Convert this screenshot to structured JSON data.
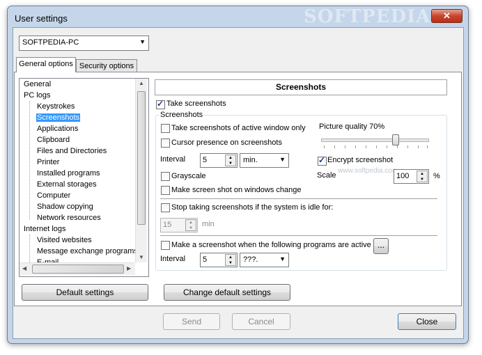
{
  "window": {
    "title": "User settings",
    "watermark": "SOFTPEDIA",
    "close_glyph": "✕"
  },
  "computer_select": {
    "value": "SOFTPEDIA-PC"
  },
  "tabs": [
    {
      "label": "General options",
      "active": true
    },
    {
      "label": "Security options",
      "active": false
    }
  ],
  "tree": {
    "items": [
      {
        "label": "General",
        "level": 0
      },
      {
        "label": "PC logs",
        "level": 0
      },
      {
        "label": "Keystrokes",
        "level": 1
      },
      {
        "label": "Screenshots",
        "level": 1,
        "selected": true
      },
      {
        "label": "Applications",
        "level": 1
      },
      {
        "label": "Clipboard",
        "level": 1
      },
      {
        "label": "Files and Directories",
        "level": 1
      },
      {
        "label": "Printer",
        "level": 1
      },
      {
        "label": "Installed programs",
        "level": 1
      },
      {
        "label": "External storages",
        "level": 1
      },
      {
        "label": "Computer",
        "level": 1
      },
      {
        "label": "Shadow copying",
        "level": 1
      },
      {
        "label": "Network resources",
        "level": 1
      },
      {
        "label": "Internet logs",
        "level": 0
      },
      {
        "label": "Visited websites",
        "level": 1
      },
      {
        "label": "Message exchange programs",
        "level": 1
      },
      {
        "label": "E-mail",
        "level": 1
      }
    ]
  },
  "panel": {
    "header": "Screenshots",
    "take_screenshots": {
      "label": "Take screenshots",
      "checked": true
    },
    "group_label": "Screenshots",
    "active_window": {
      "label": "Take screenshots of active window only",
      "checked": false
    },
    "cursor": {
      "label": "Cursor presence on screenshots",
      "checked": false
    },
    "picture_quality": {
      "label": "Picture quality 70%",
      "value": 70
    },
    "interval": {
      "label": "Interval",
      "value": "5",
      "unit": "min."
    },
    "encrypt": {
      "label": "Encrypt screenshot",
      "checked": true
    },
    "grayscale": {
      "label": "Grayscale",
      "checked": false
    },
    "scale": {
      "label": "Scale",
      "value": "100",
      "unit": "%"
    },
    "window_change": {
      "label": "Make screen shot on windows change",
      "checked": false
    },
    "idle": {
      "label": "Stop taking screenshots if the system is idle for:",
      "checked": false,
      "value": "15",
      "unit": "min"
    },
    "programs": {
      "label": "Make a screenshot when the following programs are active",
      "checked": false,
      "browse": "..."
    },
    "interval2": {
      "label": "Interval",
      "value": "5",
      "unit": "???."
    },
    "softpedia_url": "www.softpedia.com"
  },
  "buttons": {
    "default_settings": "Default settings",
    "change_default": "Change default settings",
    "send": "Send",
    "cancel": "Cancel",
    "close": "Close"
  }
}
